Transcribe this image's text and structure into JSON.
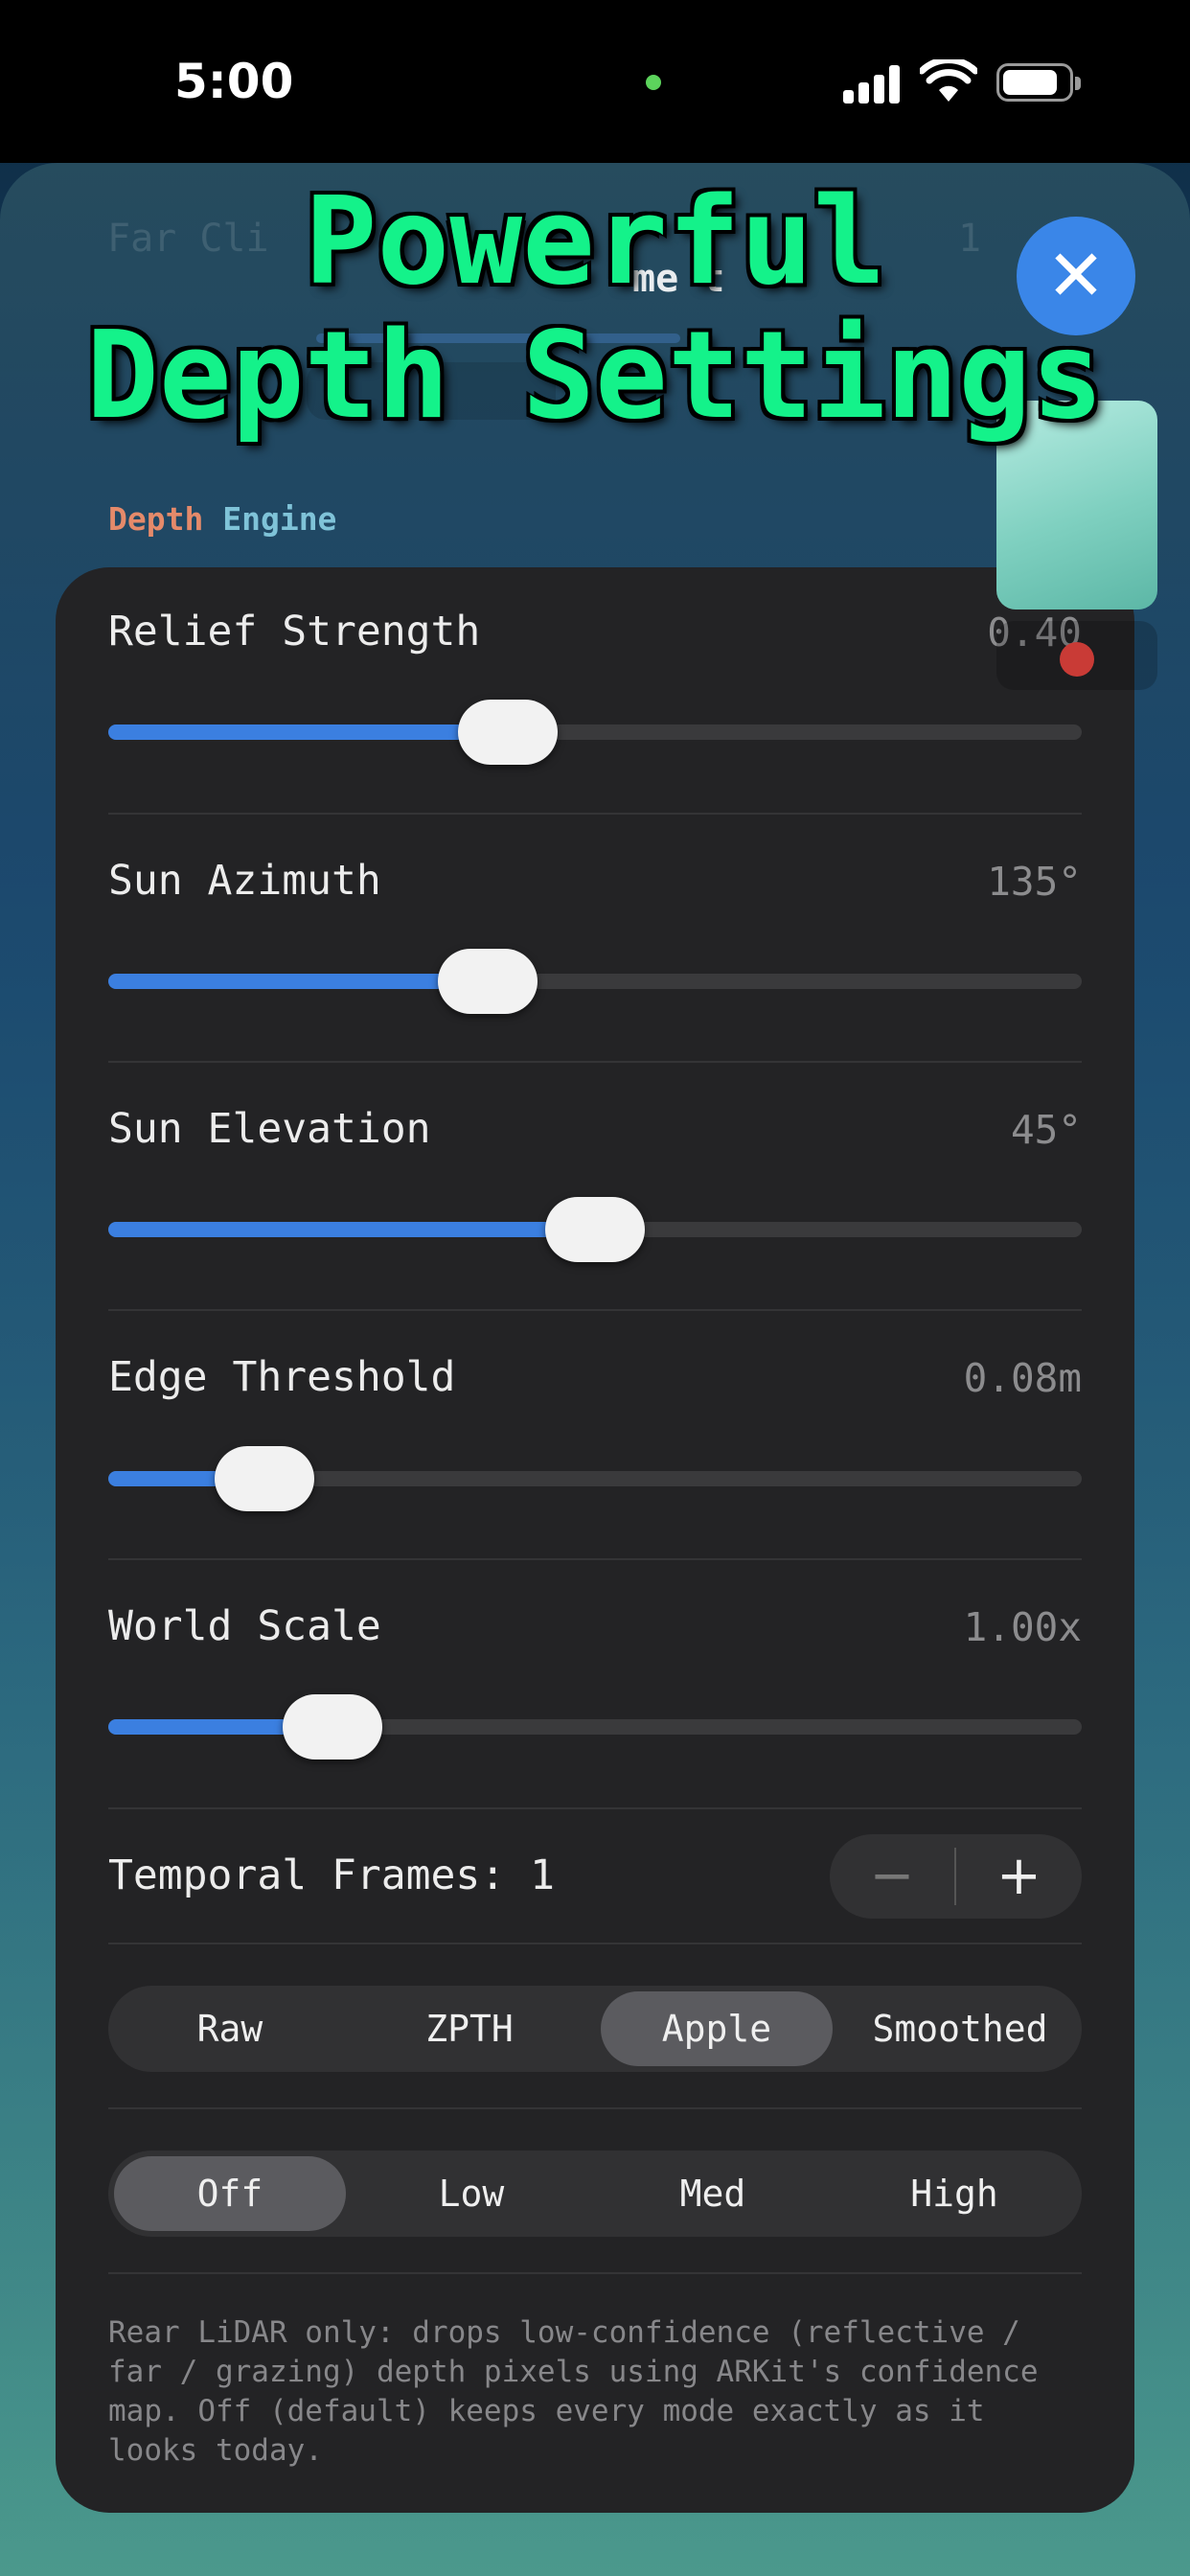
{
  "status": {
    "time": "5:00"
  },
  "headline": {
    "line1": "Powerful",
    "line2": "Depth Settings"
  },
  "background_ghost": {
    "left_label": "Far Cli",
    "center_label": "me t",
    "right_label": "1"
  },
  "close_button": {
    "glyph": "✕"
  },
  "section": {
    "label_part1": "Depth",
    "label_part2": "Engine"
  },
  "sliders": [
    {
      "title": "Relief Strength",
      "value": "0.40",
      "level": 0.41
    },
    {
      "title": "Sun Azimuth",
      "value": "135°",
      "level": 0.39
    },
    {
      "title": "Sun Elevation",
      "value": "45°",
      "level": 0.5
    },
    {
      "title": "Edge Threshold",
      "value": "0.08m",
      "level": 0.16
    },
    {
      "title": "World Scale",
      "value": "1.00x",
      "level": 0.23
    }
  ],
  "temporal": {
    "label": "Temporal Frames: 1",
    "minus": "−",
    "plus": "+"
  },
  "depth_source": {
    "options": [
      "Raw",
      "ZPTH",
      "Apple",
      "Smoothed"
    ],
    "selected": "Apple"
  },
  "confidence_filter": {
    "options": [
      "Off",
      "Low",
      "Med",
      "High"
    ],
    "selected": "Off"
  },
  "help": "Rear LiDAR only: drops low-confidence (reflective / far / grazing) depth pixels using ARKit's confidence map. Off (default) keeps every mode exactly as it looks today.",
  "colors": {
    "accent": "#3b7fe0",
    "headline": "#14f28a",
    "panel": "#232325"
  }
}
